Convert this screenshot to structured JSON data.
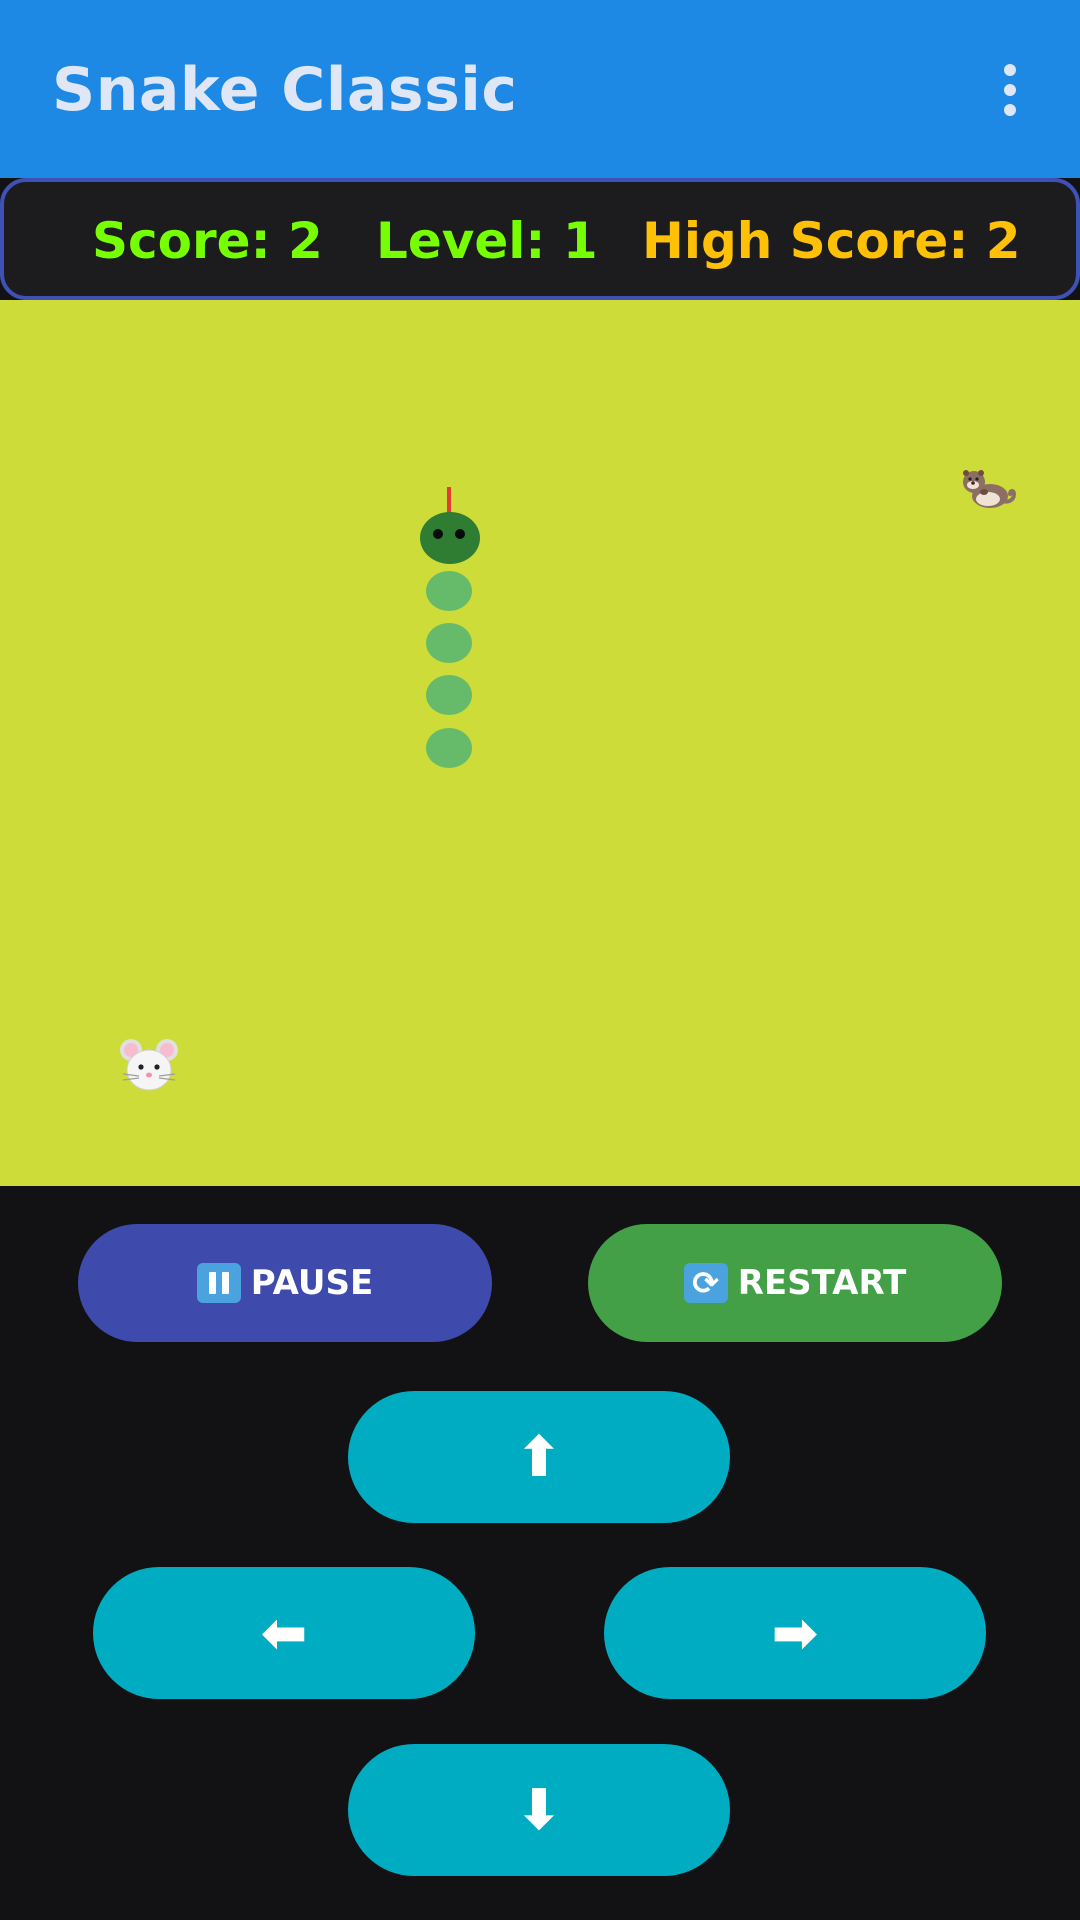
{
  "app": {
    "title": "Snake Classic",
    "menu_icon": "more-vert-icon"
  },
  "scorebar": {
    "score": "Score: 2",
    "level": "Level: 1",
    "high_score": "High Score: 2",
    "score_color": "#76ff03",
    "level_color": "#76ff03",
    "high_score_color": "#ffc107"
  },
  "board": {
    "background": "#cddc39",
    "snake_length": 5,
    "snake_direction": "up",
    "food_icons": [
      "otter-emoji-icon",
      "mouse-face-emoji-icon"
    ]
  },
  "controls": {
    "pause_label": "PAUSE",
    "pause_icon": "pause-icon",
    "restart_label": "RESTART",
    "restart_icon": "restart-arrows-icon",
    "up_label": "⬆",
    "left_label": "⬅",
    "right_label": "➡",
    "down_label": "⬇"
  },
  "colors": {
    "appbar": "#1e88e5",
    "pause_button": "#3f4aad",
    "restart_button": "#43a047",
    "direction_button": "#00acc1",
    "snake_head": "#2e7d32",
    "snake_body": "#66bb6a"
  }
}
